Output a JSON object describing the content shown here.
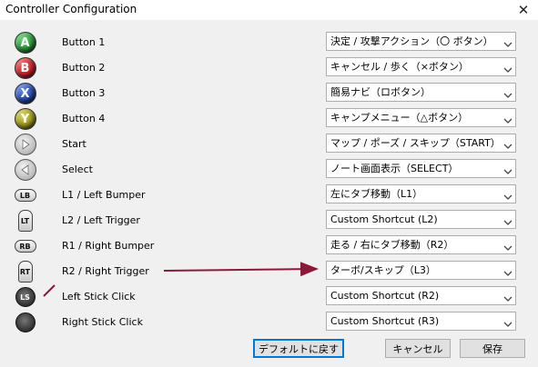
{
  "window": {
    "title": "Controller Configuration",
    "close_glyph": "✕"
  },
  "rows": [
    {
      "icon": "a-button-icon",
      "icon_text": "A",
      "icon_color": "#1e8a2e",
      "label": "Button 1",
      "value": "決定 / 攻撃アクション（〇 ボタン）"
    },
    {
      "icon": "b-button-icon",
      "icon_text": "B",
      "icon_color": "#b8161e",
      "label": "Button 2",
      "value": "キャンセル / 歩く（×ボタン）"
    },
    {
      "icon": "x-button-icon",
      "icon_text": "X",
      "icon_color": "#1b3f9c",
      "label": "Button 3",
      "value": "簡易ナビ（ロボタン）"
    },
    {
      "icon": "y-button-icon",
      "icon_text": "Y",
      "icon_color": "#8f8a10",
      "label": "Button 4",
      "value": "キャンプメニュー（△ボタン）"
    },
    {
      "icon": "start-button-icon",
      "icon_text": "",
      "label": "Start",
      "value": "マップ / ポーズ / スキップ（START）"
    },
    {
      "icon": "select-button-icon",
      "icon_text": "",
      "label": "Select",
      "value": "ノート画面表示（SELECT）"
    },
    {
      "icon": "left-bumper-icon",
      "icon_text": "LB",
      "label": "L1 / Left Bumper",
      "value": "左にタブ移動（L1）"
    },
    {
      "icon": "left-trigger-icon",
      "icon_text": "LT",
      "label": "L2 / Left Trigger",
      "value": "Custom Shortcut (L2)"
    },
    {
      "icon": "right-bumper-icon",
      "icon_text": "RB",
      "label": "R1 / Right Bumper",
      "value": "走る / 右にタブ移動（R2）"
    },
    {
      "icon": "right-trigger-icon",
      "icon_text": "RT",
      "label": "R2 / Right Trigger",
      "value": "ターボ/スキップ（L3）"
    },
    {
      "icon": "left-stick-icon",
      "icon_text": "LS",
      "label": "Left Stick Click",
      "value": "Custom Shortcut (R2)"
    },
    {
      "icon": "right-stick-icon",
      "icon_text": "",
      "label": "Right Stick Click",
      "value": "Custom Shortcut (R3)"
    }
  ],
  "footer": {
    "default_label": "デフォルトに戻す",
    "cancel_label": "キャンセル",
    "save_label": "保存"
  },
  "annotation_color": "#8b1a3a"
}
